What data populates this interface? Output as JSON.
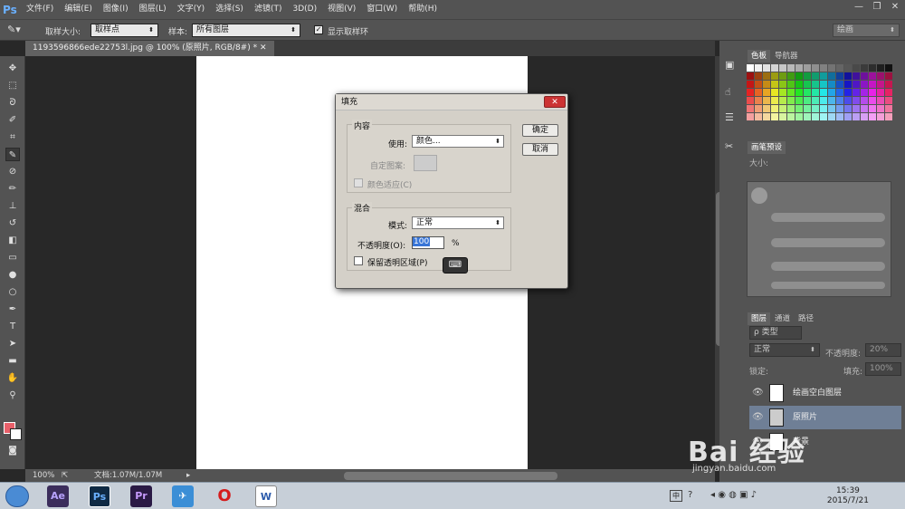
{
  "menubar": {
    "logo": "Ps",
    "items": [
      "文件(F)",
      "编辑(E)",
      "图像(I)",
      "图层(L)",
      "文字(Y)",
      "选择(S)",
      "滤镜(T)",
      "3D(D)",
      "视图(V)",
      "窗口(W)",
      "帮助(H)"
    ],
    "min": "—",
    "max": "❐",
    "close": "✕"
  },
  "options": {
    "sample_size_label": "取样大小:",
    "sample_size_value": "取样点",
    "sample_label": "样本:",
    "sample_value": "所有图层",
    "show_ring_label": "显示取样环",
    "workspace": "绘画"
  },
  "document": {
    "tab_title": "1193596866ede22753l.jpg @ 100% (原照片, RGB/8#) *",
    "zoom": "100%",
    "doc_info": "文档:1.07M/1.07M"
  },
  "panels": {
    "swatches_tab": "色板",
    "navigator_tab": "导航器",
    "brush_preset_tab": "画笔预设",
    "size_label": "大小:",
    "layers_tab": "图层",
    "channels_tab": "通道",
    "paths_tab": "路径",
    "kind_filter": "ρ 类型",
    "blend_mode": "正常",
    "opacity_label": "不透明度:",
    "opacity_value": "20%",
    "lock_label": "锁定:",
    "fill_label": "填充:",
    "fill_value": "100%",
    "layers": [
      {
        "name": "绘画空白图层"
      },
      {
        "name": "原照片"
      },
      {
        "name": "背景"
      }
    ]
  },
  "dialog": {
    "title": "填充",
    "close": "✕",
    "content_group": "内容",
    "use_label": "使用:",
    "use_value": "颜色...",
    "custom_pattern_label": "自定图案:",
    "color_adapt_label": "颜色适应(C)",
    "blend_group": "混合",
    "mode_label": "模式:",
    "mode_value": "正常",
    "opacity_label": "不透明度(O):",
    "opacity_value": "100",
    "percent": "%",
    "preserve_label": "保留透明区域(P)",
    "ok_label": "确定",
    "cancel_label": "取消"
  },
  "taskbar": {
    "start_label": "开始",
    "apps": [
      "Ae",
      "Ps",
      "Pr",
      "",
      "",
      ""
    ],
    "ime": "中",
    "time": "15:39",
    "date": "2015/7/21"
  },
  "watermark": {
    "brand": "Bai 经验",
    "url": "jingyan.baidu.com"
  },
  "colors": {
    "foreground": "#e8606a",
    "background": "#ffffff"
  }
}
